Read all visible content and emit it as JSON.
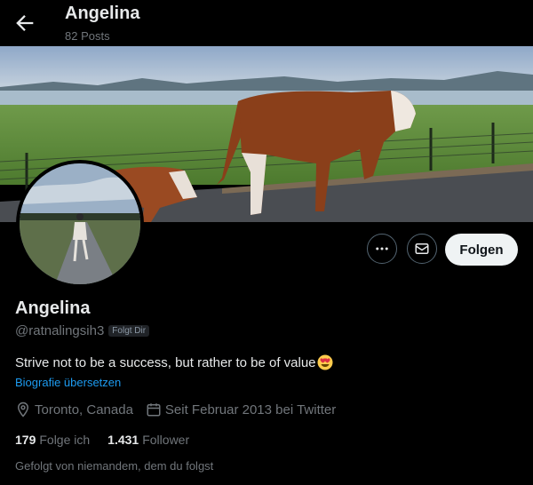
{
  "header": {
    "title": "Angelina",
    "posts_count": "82 Posts"
  },
  "actions": {
    "follow_label": "Folgen",
    "more_icon": "more-horizontal-icon",
    "message_icon": "envelope-icon"
  },
  "profile": {
    "name": "Angelina",
    "handle": "@ratnalingsih3",
    "follows_you_badge": "Folgt Dir",
    "bio": "Strive not to be a success, but rather to be of value",
    "bio_emoji": "heart-eyes-emoji",
    "translate_link": "Biografie übersetzen",
    "location": "Toronto, Canada",
    "joined": "Seit Februar 2013 bei Twitter"
  },
  "stats": {
    "following_count": "179",
    "following_label": "Folge ich",
    "followers_count": "1.431",
    "followers_label": "Follower"
  },
  "followed_by": "Gefolgt von niemandem, dem du folgst",
  "colors": {
    "background": "#000000",
    "text": "#e7e9ea",
    "muted": "#71767b",
    "link": "#1d9bf0",
    "button_bg": "#eff3f4"
  }
}
